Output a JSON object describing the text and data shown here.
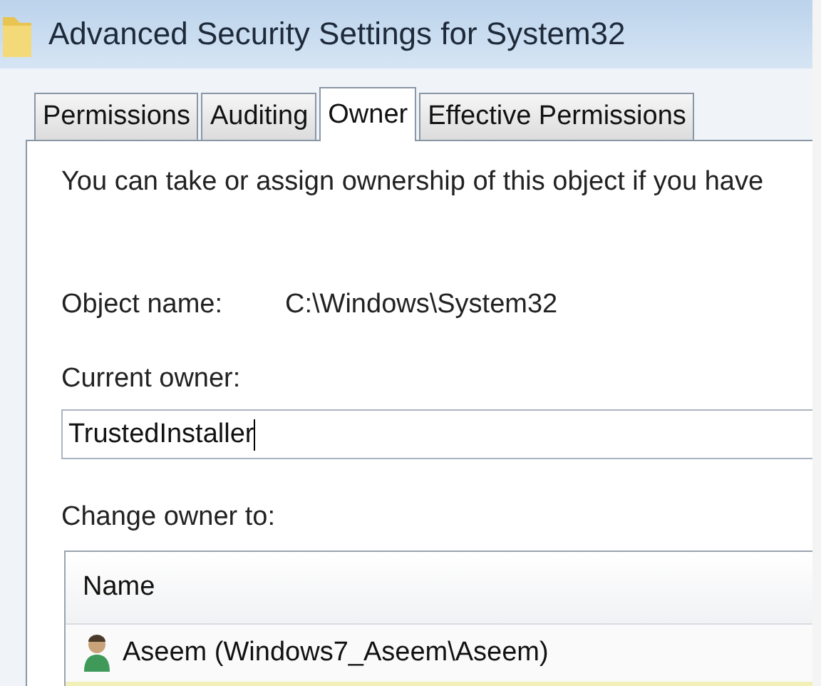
{
  "window": {
    "title": "Advanced Security Settings for System32"
  },
  "tabs": [
    {
      "label": "Permissions",
      "selected": false
    },
    {
      "label": "Auditing",
      "selected": false
    },
    {
      "label": "Owner",
      "selected": true
    },
    {
      "label": "Effective Permissions",
      "selected": false
    }
  ],
  "intro": "You can take or assign ownership of this object if you have",
  "object_name": {
    "label": "Object name:",
    "value": "C:\\Windows\\System32"
  },
  "current_owner": {
    "label": "Current owner:",
    "value": "TrustedInstaller"
  },
  "change_owner": {
    "label": "Change owner to:",
    "columns": [
      "Name"
    ],
    "rows": [
      {
        "name": "Aseem (Windows7_Aseem\\Aseem)",
        "selected": false
      }
    ]
  }
}
